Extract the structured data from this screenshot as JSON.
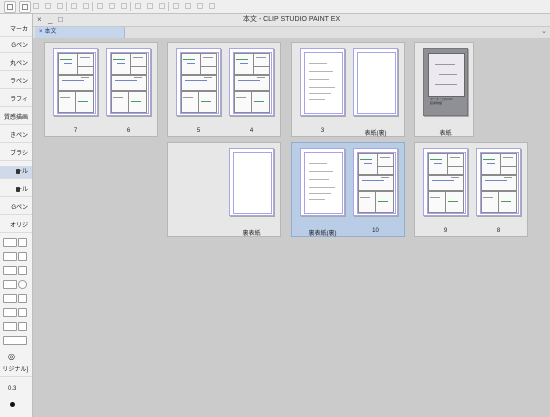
{
  "window": {
    "title": "本文 - CLIP STUDIO PAINT EX",
    "close": "×",
    "minimize": "_",
    "maximize": "□"
  },
  "toolbar": {
    "buttons": [
      {
        "icon": "cloud-icon"
      },
      {
        "icon": "new-file-icon"
      },
      {
        "icon": "open-folder-icon"
      },
      {
        "icon": "save-icon"
      },
      {
        "icon": "print-icon"
      },
      {
        "icon": "undo-icon"
      },
      {
        "icon": "redo-icon"
      },
      {
        "icon": "transform-icon"
      },
      {
        "icon": "clear-icon"
      },
      {
        "icon": "fill-icon"
      },
      {
        "icon": "select-all-icon"
      },
      {
        "icon": "deselect-icon"
      },
      {
        "icon": "invert-selection-icon"
      },
      {
        "icon": "ruler-icon"
      },
      {
        "icon": "snap-ruler-icon"
      },
      {
        "icon": "snap-grid-icon"
      },
      {
        "icon": "perspective-icon"
      }
    ]
  },
  "tab": {
    "close": "×",
    "label": "本文",
    "scroll_icon": "chevron-down-icon"
  },
  "left_panel": {
    "top_item": "マーカ",
    "tools": [
      {
        "label": "Gペン",
        "locked": false
      },
      {
        "label": "丸ペン",
        "locked": false
      },
      {
        "label": "ラペン",
        "locked": false
      },
      {
        "label": "ラフィ",
        "locked": false
      },
      {
        "label": "質感描画",
        "locked": false
      },
      {
        "label": "きペン",
        "locked": false
      },
      {
        "label": "ブラシ",
        "locked": false
      },
      {
        "label": "ール",
        "locked": true
      },
      {
        "label": "ール",
        "locked": true
      },
      {
        "label": "Gペン",
        "locked": false
      }
    ],
    "sub_label": "オリジ",
    "value_label": "0.3",
    "bottom_label": "リジナル]"
  },
  "spreads": [
    {
      "selected": false,
      "pages": [
        {
          "label": "7",
          "kind": "manga"
        },
        {
          "label": "6",
          "kind": "manga"
        }
      ]
    },
    {
      "selected": false,
      "pages": [
        {
          "label": "5",
          "kind": "manga"
        },
        {
          "label": "4",
          "kind": "manga"
        }
      ]
    },
    {
      "selected": false,
      "pages": [
        {
          "label": "3",
          "kind": "text"
        },
        {
          "label": "表紙(裏)",
          "kind": "blank"
        }
      ]
    },
    {
      "selected": false,
      "pages": [
        {
          "label": "表紙",
          "kind": "cover",
          "cover_text": "ヤーカ・ロGOch\n起承物語"
        }
      ]
    },
    {
      "selected": false,
      "pages": [
        {
          "label": "裏表紙",
          "kind": "blank"
        }
      ]
    },
    {
      "selected": true,
      "pages": [
        {
          "label": "裏表紙(裏)",
          "kind": "text"
        },
        {
          "label": "10",
          "kind": "manga"
        }
      ]
    },
    {
      "selected": false,
      "pages": [
        {
          "label": "9",
          "kind": "manga"
        },
        {
          "label": "8",
          "kind": "manga"
        }
      ]
    }
  ]
}
